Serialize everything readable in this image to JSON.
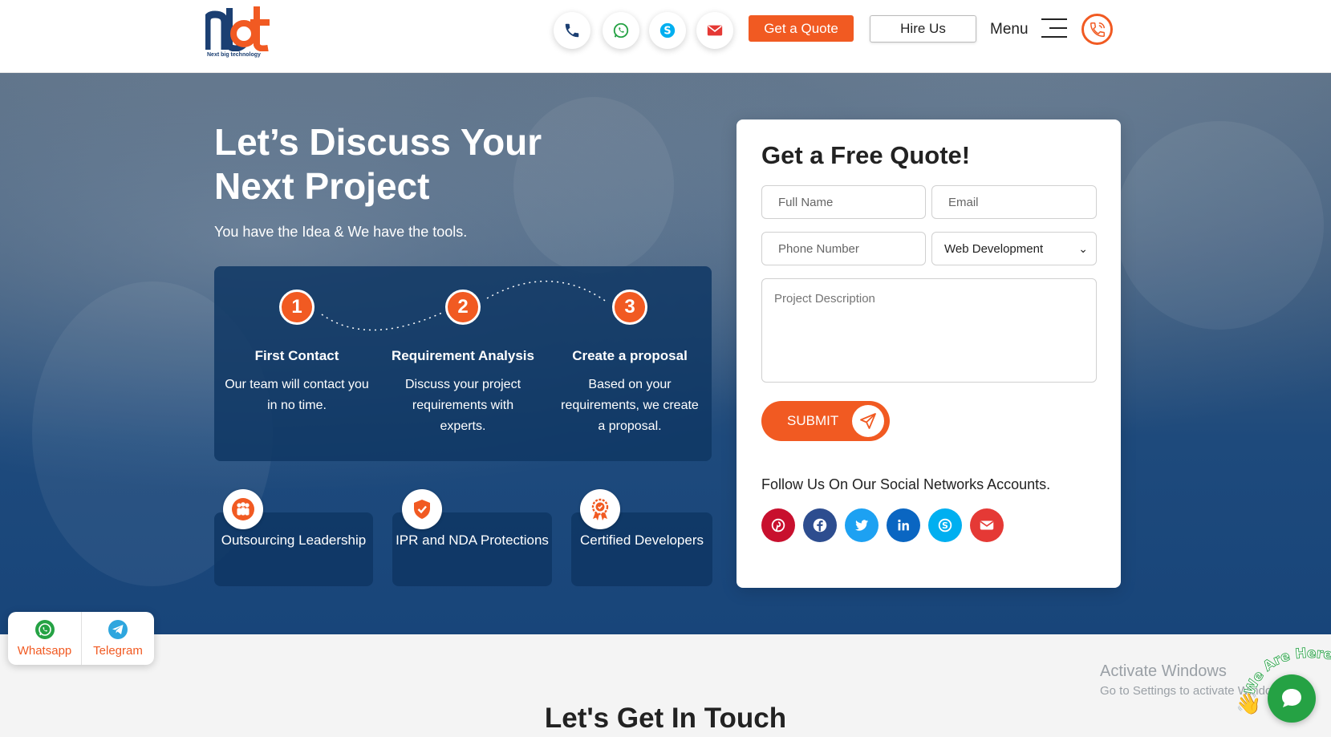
{
  "header": {
    "logo_mark": "nbt",
    "logo_tagline": "Next big technology",
    "contact_icons": [
      "phone-icon",
      "whatsapp-icon",
      "skype-icon",
      "email-icon"
    ],
    "get_quote_label": "Get a Quote",
    "hire_us_label": "Hire Us",
    "menu_label": "Menu"
  },
  "hero": {
    "title": "Let’s Discuss Your Next Project",
    "subtitle": "You have the Idea & We have the tools.",
    "steps": [
      {
        "num": "1",
        "title": "First Contact",
        "desc": "Our team will contact you in no time."
      },
      {
        "num": "2",
        "title": "Requirement Analysis",
        "desc": "Discuss your project requirements with experts."
      },
      {
        "num": "3",
        "title": "Create a proposal",
        "desc": "Based on your requirements, we create a proposal."
      }
    ],
    "features": [
      {
        "label": "Outsourcing Leadership",
        "icon": "team-icon"
      },
      {
        "label": "IPR and NDA Protections",
        "icon": "shield-check-icon"
      },
      {
        "label": "Certified Developers",
        "icon": "certificate-badge-icon"
      }
    ]
  },
  "quote_form": {
    "title": "Get a Free Quote!",
    "full_name_placeholder": "Full Name",
    "email_placeholder": "Email",
    "phone_placeholder": "Phone Number",
    "service_selected": "Web Development",
    "description_placeholder": "Project Description",
    "submit_label": "SUBMIT",
    "follow_text": "Follow Us On Our Social Networks Accounts.",
    "socials": [
      {
        "icon": "pinterest-icon",
        "color": "#c8102e"
      },
      {
        "icon": "facebook-icon",
        "color": "#2d4d8f"
      },
      {
        "icon": "twitter-icon",
        "color": "#1da1f2"
      },
      {
        "icon": "linkedin-icon",
        "color": "#0a66c2"
      },
      {
        "icon": "skype-icon",
        "color": "#00aff0"
      },
      {
        "icon": "email-icon",
        "color": "#e53935"
      }
    ]
  },
  "floating": {
    "whatsapp_label": "Whatsapp",
    "telegram_label": "Telegram"
  },
  "bottom": {
    "touch_title": "Let's Get In Touch"
  },
  "activate_windows": {
    "line1": "Activate Windows",
    "line2": "Go to Settings to activate Windows."
  },
  "chat_widget": {
    "badge_text": "We Are Here!"
  },
  "colors": {
    "accent": "#f15a22",
    "brand_blue": "#1b3f72",
    "hero_panel": "#0f3764"
  }
}
